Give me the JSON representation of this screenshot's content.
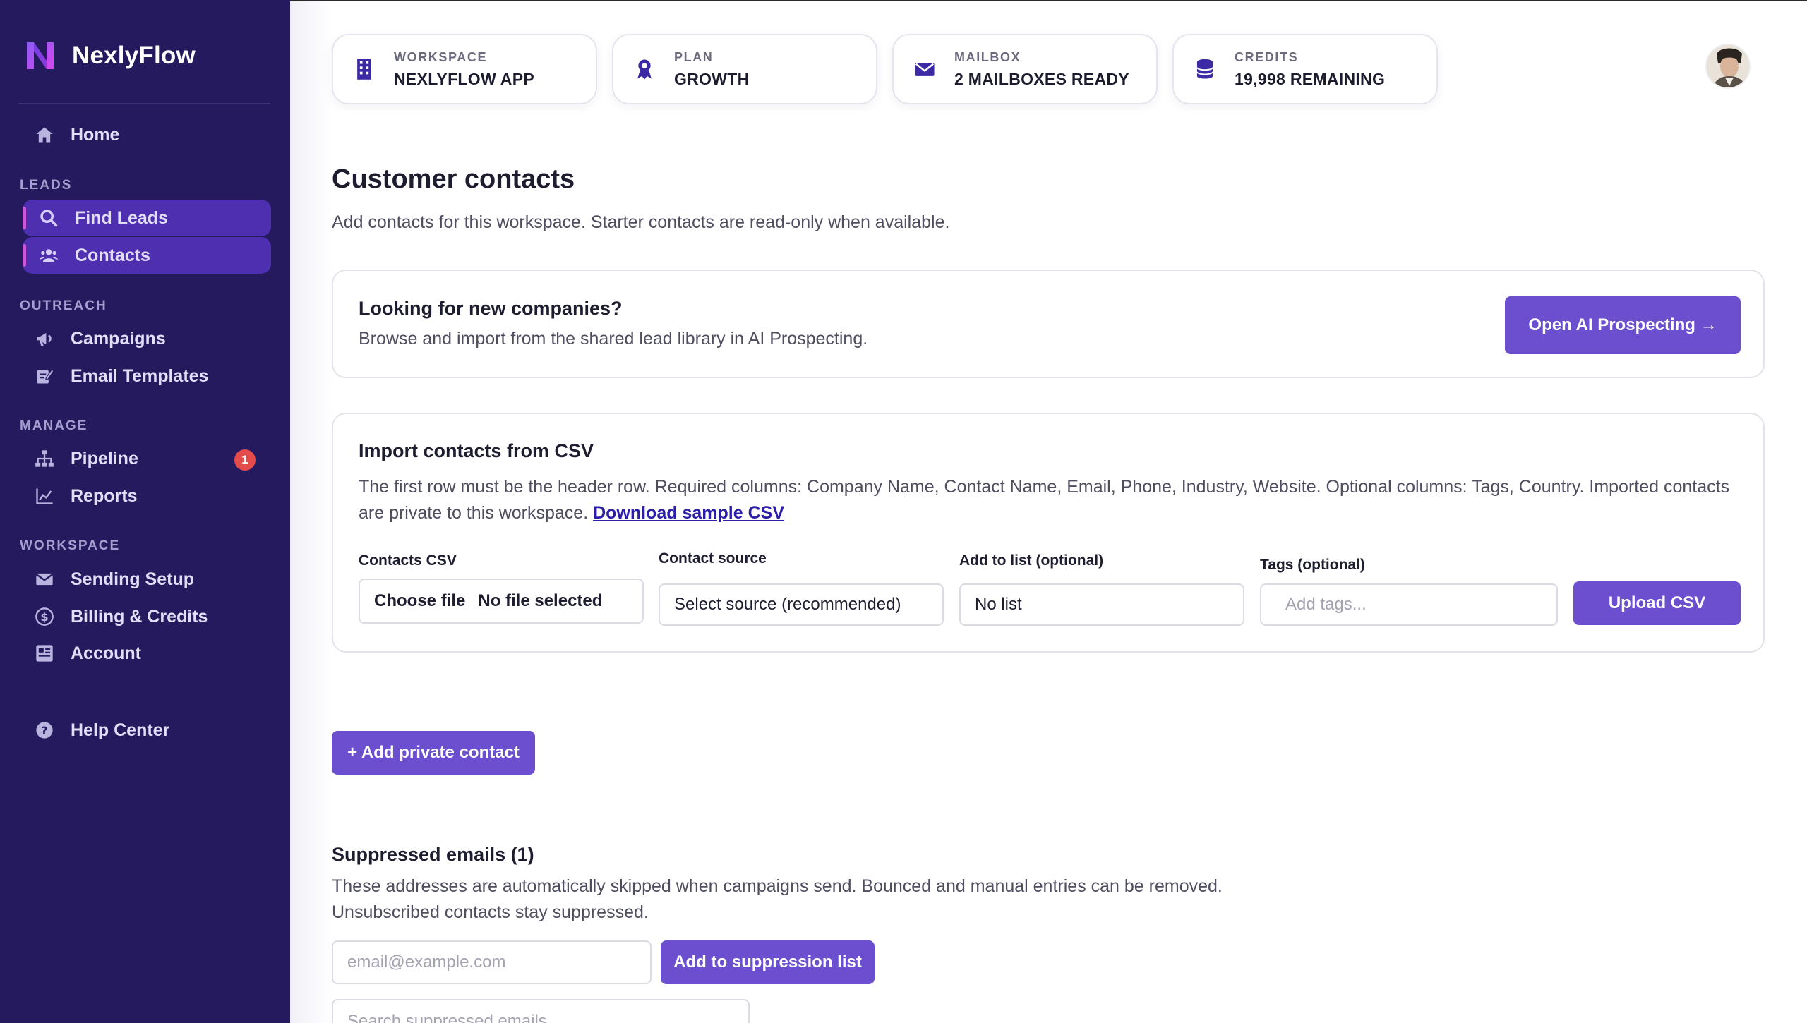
{
  "brand": {
    "name": "NexlyFlow"
  },
  "sidebar": {
    "home": "Home",
    "sections": {
      "leads": "LEADS",
      "outreach": "OUTREACH",
      "manage": "MANAGE",
      "workspace": "WORKSPACE"
    },
    "items": {
      "find_leads": "Find Leads",
      "contacts": "Contacts",
      "campaigns": "Campaigns",
      "email_templates": "Email Templates",
      "pipeline": "Pipeline",
      "pipeline_badge": "1",
      "reports": "Reports",
      "sending_setup": "Sending Setup",
      "billing_credits": "Billing & Credits",
      "account": "Account",
      "help_center": "Help Center"
    },
    "active_items": [
      "Find Leads",
      "Contacts"
    ]
  },
  "stats": [
    {
      "label": "WORKSPACE",
      "value": "NEXLYFLOW APP",
      "icon": "building-icon"
    },
    {
      "label": "PLAN",
      "value": "GROWTH",
      "icon": "award-icon"
    },
    {
      "label": "MAILBOX",
      "value": "2 MAILBOXES READY",
      "icon": "envelope-icon"
    },
    {
      "label": "CREDITS",
      "value": "19,998 REMAINING",
      "icon": "database-icon"
    }
  ],
  "page": {
    "title": "Customer contacts",
    "subtitle": "Add contacts for this workspace. Starter contacts are read-only when available."
  },
  "prospecting": {
    "title": "Looking for new companies?",
    "text": "Browse and import from the shared lead library in AI Prospecting.",
    "button": "Open AI Prospecting →"
  },
  "import_csv": {
    "title": "Import contacts from CSV",
    "text": "The first row must be the header row. Required columns: Company Name, Contact Name, Email, Phone, Industry, Website. Optional columns: Tags, Country. Imported contacts are private to this workspace.",
    "link": "Download sample CSV",
    "file_label": "Contacts CSV",
    "file_button": "Choose file",
    "file_status": "No file selected",
    "source_label": "Contact source",
    "source_value": "Select source (recommended)",
    "list_label": "Add to list (optional)",
    "list_value": "No list",
    "tags_label": "Tags (optional)",
    "tags_placeholder": "Add tags...",
    "upload_button": "Upload CSV"
  },
  "add_private_contact": "+ Add private contact",
  "suppressed": {
    "title": "Suppressed emails (1)",
    "text": "These addresses are automatically skipped when campaigns send. Bounced and manual entries can be removed. Unsubscribed contacts stay suppressed.",
    "email_placeholder": "email@example.com",
    "add_button": "Add to suppression list",
    "search_placeholder": "Search suppressed emails"
  },
  "colors": {
    "sidebar_bg": "#251a5e",
    "accent": "#6b4fcf",
    "active_nav": "#4e2fb0",
    "badge": "#e54b4b",
    "link": "#2b1fa8"
  }
}
